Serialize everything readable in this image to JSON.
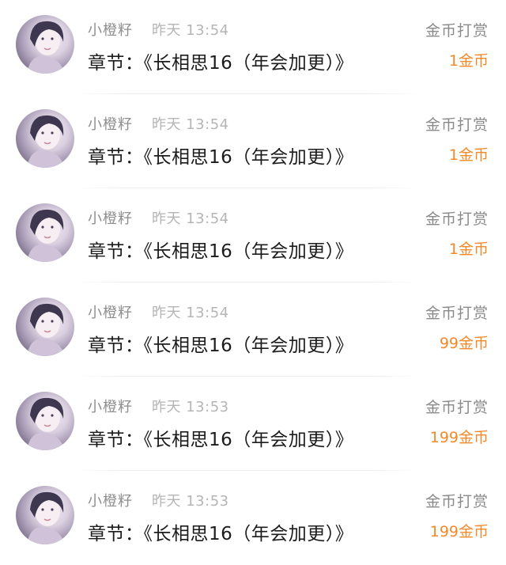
{
  "colors": {
    "amount": "#f28a2c",
    "name": "#8e8e8e",
    "time": "#b5b5b5",
    "chapter": "#1c1c1c"
  },
  "records": [
    {
      "name": "小橙籽",
      "time": "昨天 13:54",
      "chapter": "章节：《长相思16（年会加更）》",
      "kind": "金币打赏",
      "amount": "1金币"
    },
    {
      "name": "小橙籽",
      "time": "昨天 13:54",
      "chapter": "章节：《长相思16（年会加更）》",
      "kind": "金币打赏",
      "amount": "1金币"
    },
    {
      "name": "小橙籽",
      "time": "昨天 13:54",
      "chapter": "章节：《长相思16（年会加更）》",
      "kind": "金币打赏",
      "amount": "1金币"
    },
    {
      "name": "小橙籽",
      "time": "昨天 13:54",
      "chapter": "章节：《长相思16（年会加更）》",
      "kind": "金币打赏",
      "amount": "99金币"
    },
    {
      "name": "小橙籽",
      "time": "昨天 13:53",
      "chapter": "章节：《长相思16（年会加更）》",
      "kind": "金币打赏",
      "amount": "199金币"
    },
    {
      "name": "小橙籽",
      "time": "昨天 13:53",
      "chapter": "章节：《长相思16（年会加更）》",
      "kind": "金币打赏",
      "amount": "199金币"
    }
  ]
}
